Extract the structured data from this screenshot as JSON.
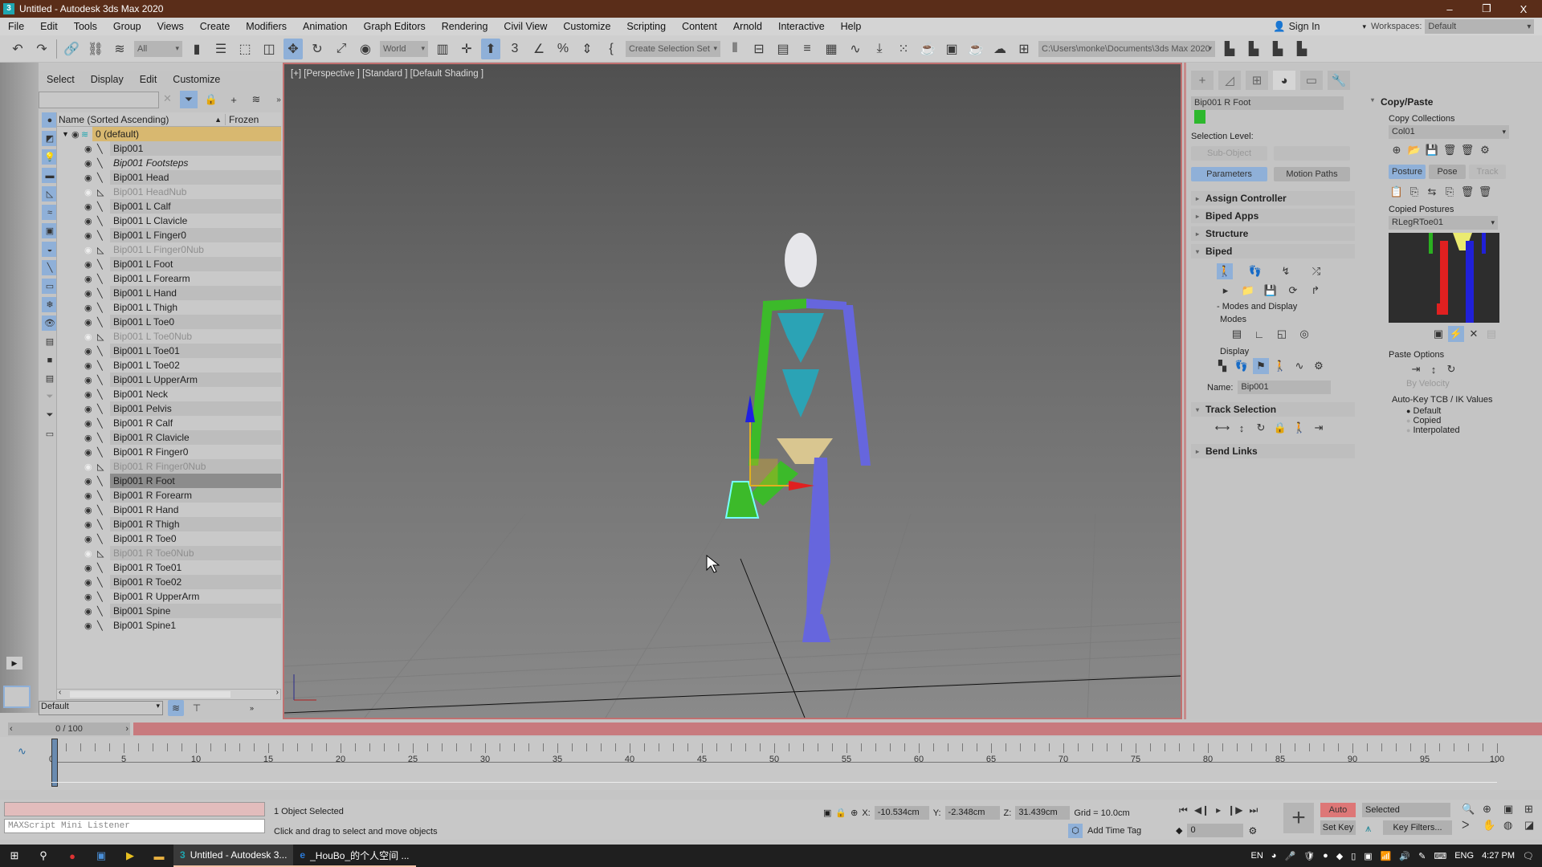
{
  "window": {
    "title": "Untitled - Autodesk 3ds Max 2020",
    "app_icon": "3",
    "controls": [
      "minimize-icon",
      "restore-icon",
      "close-icon"
    ],
    "control_glyphs": [
      "–",
      "❐",
      "X"
    ]
  },
  "menu": {
    "items": [
      "File",
      "Edit",
      "Tools",
      "Group",
      "Views",
      "Create",
      "Modifiers",
      "Animation",
      "Graph Editors",
      "Rendering",
      "Civil View",
      "Customize",
      "Scripting",
      "Content",
      "Arnold",
      "Interactive",
      "Help"
    ],
    "sign_in": "Sign In",
    "workspaces_label": "Workspaces:",
    "workspaces_value": "Default"
  },
  "toolbar": {
    "selection_filter": "All",
    "coord_system": "World",
    "named_selection": "Create Selection Set",
    "project_path": "C:\\Users\\monke\\Documents\\3ds Max 2020"
  },
  "scene_explorer": {
    "menu": [
      "Select",
      "Display",
      "Edit",
      "Customize"
    ],
    "search_placeholder": "",
    "header_name": "Name (Sorted Ascending)",
    "header_sort": "▲",
    "header_frozen": "Frozen",
    "layer": "0 (default)",
    "items": [
      {
        "name": "Bip001",
        "type": "bone"
      },
      {
        "name": "Bip001 Footsteps",
        "type": "italic"
      },
      {
        "name": "Bip001 Head",
        "type": "bone"
      },
      {
        "name": "Bip001 HeadNub",
        "type": "nub"
      },
      {
        "name": "Bip001 L Calf",
        "type": "bone"
      },
      {
        "name": "Bip001 L Clavicle",
        "type": "bone"
      },
      {
        "name": "Bip001 L Finger0",
        "type": "bone"
      },
      {
        "name": "Bip001 L Finger0Nub",
        "type": "nub"
      },
      {
        "name": "Bip001 L Foot",
        "type": "bone"
      },
      {
        "name": "Bip001 L Forearm",
        "type": "bone"
      },
      {
        "name": "Bip001 L Hand",
        "type": "bone"
      },
      {
        "name": "Bip001 L Thigh",
        "type": "bone"
      },
      {
        "name": "Bip001 L Toe0",
        "type": "bone"
      },
      {
        "name": "Bip001 L Toe0Nub",
        "type": "nub"
      },
      {
        "name": "Bip001 L Toe01",
        "type": "bone"
      },
      {
        "name": "Bip001 L Toe02",
        "type": "bone"
      },
      {
        "name": "Bip001 L UpperArm",
        "type": "bone"
      },
      {
        "name": "Bip001 Neck",
        "type": "bone"
      },
      {
        "name": "Bip001 Pelvis",
        "type": "bone"
      },
      {
        "name": "Bip001 R Calf",
        "type": "bone"
      },
      {
        "name": "Bip001 R Clavicle",
        "type": "bone"
      },
      {
        "name": "Bip001 R Finger0",
        "type": "bone"
      },
      {
        "name": "Bip001 R Finger0Nub",
        "type": "nub"
      },
      {
        "name": "Bip001 R Foot",
        "type": "selected"
      },
      {
        "name": "Bip001 R Forearm",
        "type": "bone"
      },
      {
        "name": "Bip001 R Hand",
        "type": "bone"
      },
      {
        "name": "Bip001 R Thigh",
        "type": "bone"
      },
      {
        "name": "Bip001 R Toe0",
        "type": "bone"
      },
      {
        "name": "Bip001 R Toe0Nub",
        "type": "nub"
      },
      {
        "name": "Bip001 R Toe01",
        "type": "bone"
      },
      {
        "name": "Bip001 R Toe02",
        "type": "bone"
      },
      {
        "name": "Bip001 R UpperArm",
        "type": "bone"
      },
      {
        "name": "Bip001 Spine",
        "type": "bone"
      },
      {
        "name": "Bip001 Spine1",
        "type": "bone"
      }
    ],
    "layer_dropdown": "Default"
  },
  "viewport": {
    "label": "[+] [Perspective ] [Standard ] [Default Shading ]",
    "gizmo_axes": [
      "X",
      "Y",
      "Z"
    ]
  },
  "command_panel": {
    "object_name": "Bip001 R Foot",
    "object_color": "#2db82d",
    "selection_level_label": "Selection Level:",
    "sub_object": "Sub-Object",
    "parameters": "Parameters",
    "motion_paths": "Motion Paths",
    "rollouts": [
      "Assign Controller",
      "Biped Apps",
      "Structure",
      "Biped"
    ],
    "modes_and_display": "- Modes and Display",
    "modes_label": "Modes",
    "display_label": "Display",
    "name_label": "Name:",
    "name_value": "Bip001",
    "track_selection": "Track Selection",
    "bend_links": "Bend Links",
    "copy_paste": {
      "title": "Copy/Paste",
      "copy_collections": "Copy Collections",
      "collection": "Col01",
      "tabs": [
        "Posture",
        "Pose",
        "Track"
      ],
      "copied_postures": "Copied Postures",
      "posture": "RLegRToe01",
      "paste_options": "Paste Options",
      "by_velocity": "By Velocity",
      "autokey_label": "Auto-Key TCB / IK Values",
      "autokey_options": [
        "Default",
        "Copied",
        "Interpolated"
      ],
      "autokey_selected": "Default"
    }
  },
  "timeline": {
    "slider": "0 / 100",
    "start": 0,
    "end": 100,
    "current": 0,
    "labels": [
      0,
      5,
      10,
      15,
      20,
      25,
      30,
      35,
      40,
      45,
      50,
      55,
      60,
      65,
      70,
      75,
      80,
      85,
      90,
      95,
      100
    ]
  },
  "status": {
    "maxscript_placeholder": "MAXScript Mini Listener",
    "selection": "1 Object Selected",
    "prompt": "Click and drag to select and move objects",
    "x_label": "X:",
    "x": "-10.534cm",
    "y_label": "Y:",
    "y": "-2.348cm",
    "z_label": "Z:",
    "z": "31.439cm",
    "grid": "Grid = 10.0cm",
    "add_time_tag": "Add Time Tag",
    "frame": "0",
    "auto_key": "Auto Key",
    "set_key": "Set Key",
    "key_mode": "Selected",
    "key_filters": "Key Filters..."
  },
  "taskbar": {
    "apps": [
      {
        "label": "Untitled - Autodesk 3...",
        "icon": "3ds-max-icon",
        "active": true
      },
      {
        "label": "_HouBo_的个人空间 ...",
        "icon": "edge-icon",
        "active": false
      }
    ],
    "ime": "EN",
    "lang": "ENG",
    "time": "4:27 PM"
  }
}
